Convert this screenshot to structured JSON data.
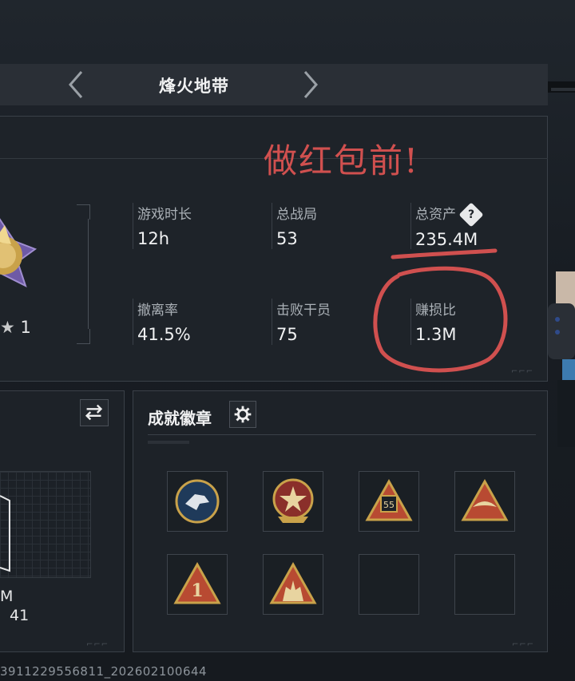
{
  "header": {
    "title": "烽火地带"
  },
  "annotation": {
    "text": "做红包前!"
  },
  "stats": [
    {
      "label": "游戏时长",
      "value": "12h"
    },
    {
      "label": "总战局",
      "value": "53"
    },
    {
      "label": "总资产",
      "value": "235.4M",
      "help": "?"
    },
    {
      "label": "撤离率",
      "value": "41.5%"
    },
    {
      "label": "击败干员",
      "value": "75"
    },
    {
      "label": "赚损比",
      "value": "1.3M"
    }
  ],
  "rank": {
    "stars": "1"
  },
  "left_panel": {
    "value_a": "M",
    "value_b": "41"
  },
  "achievements": {
    "title": "成就徽章",
    "badges": [
      "eagle-badge",
      "star-shield-badge",
      "number-55-badge",
      "wings-badge",
      "number-1-badge",
      "soldiers-badge",
      "empty",
      "empty"
    ],
    "badge_numbers": {
      "b3": "55",
      "b5": "1"
    }
  },
  "footer": {
    "id": "3911229556811_202602100644"
  },
  "colors": {
    "accent_red": "#d0504f",
    "panel_bg": "#1e2329",
    "gold": "#c9a24a"
  }
}
